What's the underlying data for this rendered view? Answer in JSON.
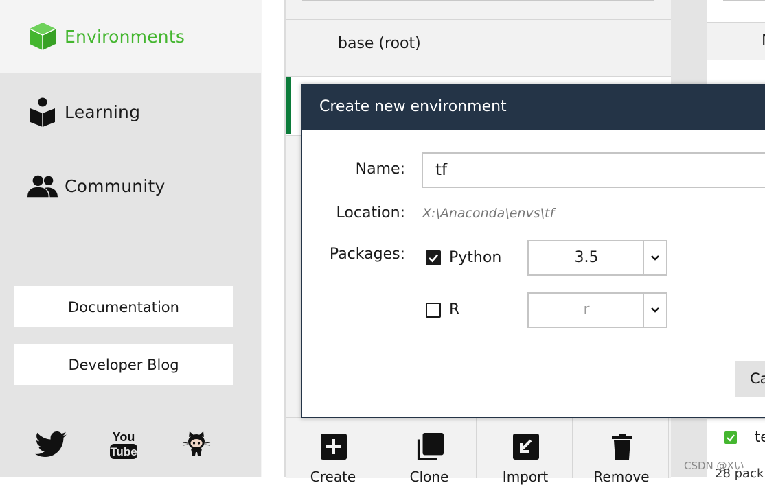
{
  "sidebar": {
    "nav": [
      {
        "label": "Environments",
        "icon": "cube-icon",
        "active": true
      },
      {
        "label": "Learning",
        "icon": "book-reader-icon",
        "active": false
      },
      {
        "label": "Community",
        "icon": "people-icon",
        "active": false
      }
    ],
    "buttons": {
      "documentation": "Documentation",
      "developer_blog": "Developer Blog"
    },
    "social": [
      "twitter-icon",
      "youtube-icon",
      "github-icon"
    ],
    "accent_color": "#44b62f"
  },
  "environments": {
    "items": [
      {
        "name": "base (root)"
      },
      {
        "name": ""
      }
    ],
    "toolbar": {
      "create": "Create",
      "clone": "Clone",
      "import": "Import",
      "remove": "Remove"
    }
  },
  "packages": {
    "header_fragment": "N",
    "row_fragment": "te",
    "count_fragment": "28 pack"
  },
  "dialog": {
    "title": "Create new environment",
    "name_label": "Name:",
    "name_value": "tf",
    "location_label": "Location:",
    "location_value": "X:\\Anaconda\\envs\\tf",
    "packages_label": "Packages:",
    "python": {
      "label": "Python",
      "checked": true,
      "version": "3.5"
    },
    "r": {
      "label": "R",
      "checked": false,
      "version": "r"
    },
    "cancel_label": "Ca",
    "header_color": "#243447"
  },
  "watermark": "CSDN @Xい"
}
